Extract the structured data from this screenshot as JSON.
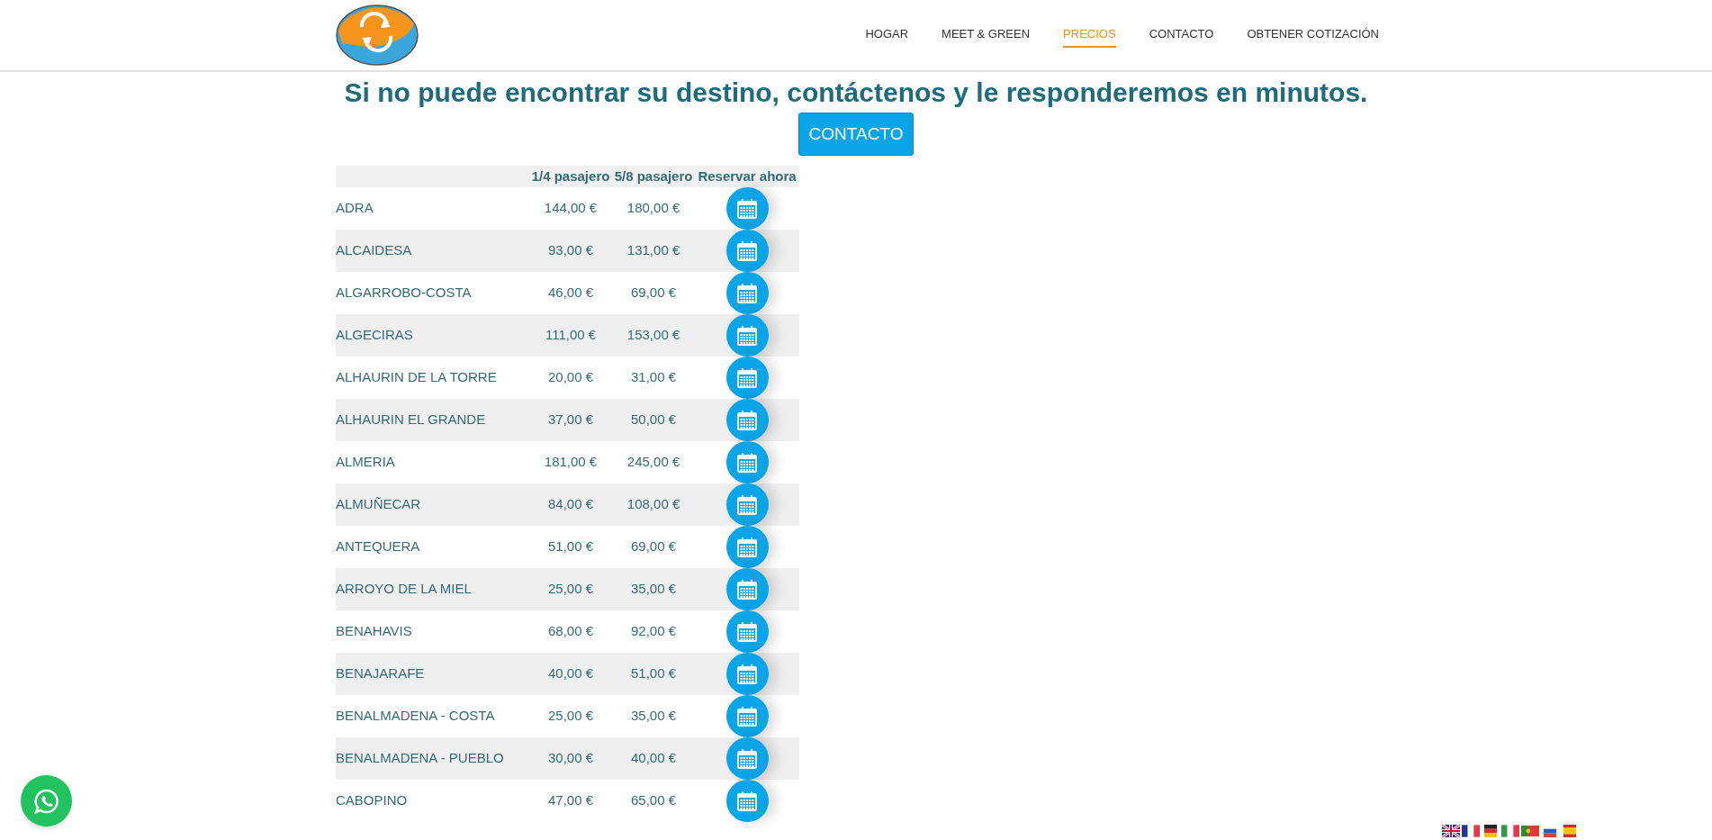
{
  "nav": [
    {
      "label": "HOGAR",
      "selected": false
    },
    {
      "label": "MEET & GREEN",
      "selected": false
    },
    {
      "label": "PRECIOS",
      "selected": true
    },
    {
      "label": "CONTACTO",
      "selected": false
    },
    {
      "label": "OBTENER COTIZACIÓN",
      "selected": false
    }
  ],
  "heading": "Si no puede encontrar su destino, contáctenos y le responderemos en minutos.",
  "contact_button": "CONTACTO",
  "table": {
    "columns": [
      "",
      "1/4 pasajero",
      "5/8 pasajero",
      "Reservar ahora"
    ],
    "rows": [
      [
        "ADRA",
        "144,00 €",
        "180,00 €"
      ],
      [
        "ALCAIDESA",
        "93,00 €",
        "131,00 €"
      ],
      [
        "ALGARROBO-COSTA",
        "46,00 €",
        "69,00 €"
      ],
      [
        "ALGECIRAS",
        "111,00 €",
        "153,00 €"
      ],
      [
        "ALHAURIN DE LA TORRE",
        "20,00 €",
        "31,00 €"
      ],
      [
        "ALHAURIN EL GRANDE",
        "37,00 €",
        "50,00 €"
      ],
      [
        "ALMERIA",
        "181,00 €",
        "245,00 €"
      ],
      [
        "ALMUÑECAR",
        "84,00 €",
        "108,00 €"
      ],
      [
        "ANTEQUERA",
        "51,00 €",
        "69,00 €"
      ],
      [
        "ARROYO DE LA MIEL",
        "25,00 €",
        "35,00 €"
      ],
      [
        "BENAHAVIS",
        "68,00 €",
        "92,00 €"
      ],
      [
        "BENAJARAFE",
        "40,00 €",
        "51,00 €"
      ],
      [
        "BENALMADENA - COSTA",
        "25,00 €",
        "35,00 €"
      ],
      [
        "BENALMADENA - PUEBLO",
        "30,00 €",
        "40,00 €"
      ],
      [
        "CABOPINO",
        "47,00 €",
        "65,00 €"
      ]
    ]
  }
}
